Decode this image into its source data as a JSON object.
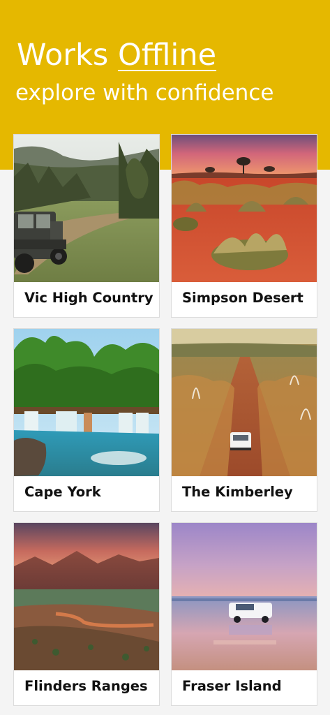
{
  "header": {
    "title_prefix": "Works ",
    "title_emphasis": "Offline",
    "subtitle": "explore with confidence"
  },
  "colors": {
    "brand_yellow": "#e5b800",
    "background": "#f4f4f4",
    "card": "#ffffff"
  },
  "regions": [
    {
      "name": "Vic High Country",
      "photo": "vic-high-country-photo"
    },
    {
      "name": "Simpson Desert",
      "photo": "simpson-desert-photo"
    },
    {
      "name": "Cape York",
      "photo": "cape-york-photo"
    },
    {
      "name": "The Kimberley",
      "photo": "the-kimberley-photo"
    },
    {
      "name": "Flinders Ranges",
      "photo": "flinders-ranges-photo"
    },
    {
      "name": "Fraser Island",
      "photo": "fraser-island-photo"
    }
  ]
}
